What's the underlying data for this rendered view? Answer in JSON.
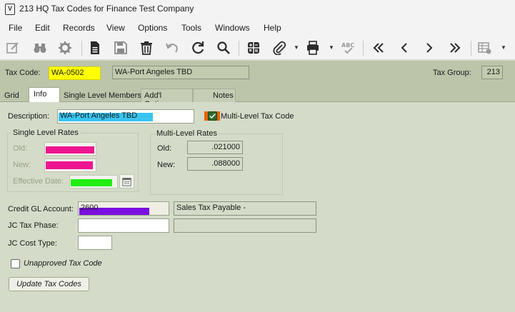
{
  "window": {
    "title": "213 HQ Tax Codes for Finance Test Company"
  },
  "menu": [
    "File",
    "Edit",
    "Records",
    "View",
    "Options",
    "Tools",
    "Windows",
    "Help"
  ],
  "toolbar": {
    "icons": [
      "checklist-edit-icon",
      "binoculars-icon",
      "gear-icon",
      "document-icon",
      "save-icon",
      "trash-icon",
      "undo-icon",
      "refresh-icon",
      "search-icon",
      "calculator-icon",
      "paperclip-icon",
      "printer-icon",
      "spellcheck-icon",
      "first-record-icon",
      "previous-record-icon",
      "next-record-icon",
      "last-record-icon",
      "grid-settings-icon"
    ]
  },
  "header": {
    "tax_code_label": "Tax Code:",
    "tax_code_value": "WA-0502",
    "tax_code_desc": "WA-Port Angeles TBD",
    "tax_group_label": "Tax Group:",
    "tax_group_value": "213",
    "highlight_color": "#ffff00"
  },
  "tabs": [
    "Grid",
    "Info",
    "Single Level Members",
    "Add'l Options",
    "Notes"
  ],
  "info": {
    "description_label": "Description:",
    "description_value": "WA-Port Angeles TBD",
    "multi_level_label": "Multi-Level Tax Code",
    "single_level_title": "Single Level Rates",
    "old_label": "Old:",
    "new_label": "New:",
    "effective_date_label": "Effective Date:",
    "multi_level_title": "Multi-Level Rates",
    "ml_old_label": "Old:",
    "ml_old_value": ".021000",
    "ml_new_label": "New:",
    "ml_new_value": ".088000",
    "credit_gl_label": "Credit GL Account:",
    "credit_gl_value": "2600",
    "credit_gl_desc": "Sales Tax Payable -",
    "jc_tax_phase_label": "JC Tax Phase:",
    "jc_cost_type_label": "JC Cost Type:",
    "unapproved_label": "Unapproved Tax Code",
    "update_button": "Update Tax Codes"
  },
  "colors": {
    "cyan": "#38c4f0",
    "magenta": "#ee1590",
    "green": "#22ee11",
    "purple": "#7b0ee0",
    "orange": "#e8620c",
    "check_green": "#2d6a2d"
  }
}
